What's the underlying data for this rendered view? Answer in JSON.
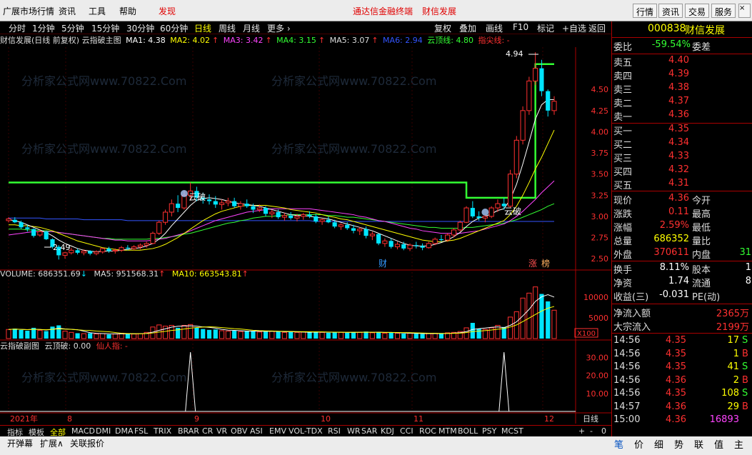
{
  "menubar": {
    "items": [
      "广展市场行情",
      "资讯",
      "工具",
      "帮助",
      "发现"
    ],
    "center_links": [
      "通达信金融终端",
      "财信发展"
    ],
    "right_buttons": [
      "行情",
      "资讯",
      "交易",
      "服务"
    ]
  },
  "period_bar": {
    "items": [
      "分时",
      "1分钟",
      "5分钟",
      "15分钟",
      "30分钟",
      "60分钟",
      "日线",
      "周线",
      "月线",
      "更多 ›"
    ],
    "active": "日线",
    "right_items": [
      "复权",
      "叠加",
      "画线",
      "F10",
      "标记",
      "+自选",
      "返回"
    ]
  },
  "chart_title": {
    "name": "财信发展(日线 前复权) 云指破主图",
    "ma1": "MA1: 4.38",
    "ma2": "MA2: 4.02",
    "ma3": "MA3: 3.42",
    "ma4": "MA4: 3.15",
    "ma5": "MA5: 3.07",
    "ma6": "MA6: 2.94",
    "yun": "云顶线: 4.80",
    "jian": "指尖线: -"
  },
  "volume_title": {
    "vol": "VOLUME: 686351.69",
    "ma5": "MA5: 951568.31",
    "ma10": "MA10: 663543.81"
  },
  "sub_title": {
    "name": "云指破副图",
    "ding": "云顶破: 0.00",
    "xian": "仙人指: -"
  },
  "annotations": {
    "high": "4.94",
    "low": "2.49",
    "yunpo1": "云破",
    "yunpo2": "云破",
    "cai": "财",
    "zhang": "涨",
    "bang": "榜"
  },
  "price_axis": [
    "4.50",
    "4.25",
    "4.00",
    "3.75",
    "3.50",
    "3.25",
    "3.00",
    "2.75",
    "2.50"
  ],
  "volume_axis": [
    "10000",
    "5000",
    "X100"
  ],
  "sub_axis": [
    "30.00",
    "20.00",
    "10.00"
  ],
  "date_axis": [
    "2021年",
    "8",
    "9",
    "10",
    "11",
    "12"
  ],
  "date_axis_right": "日线",
  "right_panel": {
    "code": "000838",
    "name": "财信发展",
    "weibi_label": "委比",
    "weibi_value": "-59.54%",
    "weicha_label": "委差",
    "sell": [
      {
        "label": "卖五",
        "price": "4.40"
      },
      {
        "label": "卖四",
        "price": "4.39"
      },
      {
        "label": "卖三",
        "price": "4.38"
      },
      {
        "label": "卖二",
        "price": "4.37"
      },
      {
        "label": "卖一",
        "price": "4.36"
      }
    ],
    "buy": [
      {
        "label": "买一",
        "price": "4.35"
      },
      {
        "label": "买二",
        "price": "4.34"
      },
      {
        "label": "买三",
        "price": "4.33"
      },
      {
        "label": "买四",
        "price": "4.32"
      },
      {
        "label": "买五",
        "price": "4.31"
      }
    ],
    "stats": [
      {
        "l1": "现价",
        "v1": "4.36",
        "l2": "今开",
        "v2": ""
      },
      {
        "l1": "涨跌",
        "v1": "0.11",
        "l2": "最高",
        "v2": ""
      },
      {
        "l1": "涨幅",
        "v1": "2.59%",
        "l2": "最低",
        "v2": ""
      },
      {
        "l1": "总量",
        "v1": "686352",
        "l2": "量比",
        "v2": ""
      },
      {
        "l1": "外盘",
        "v1": "370611",
        "l2": "内盘",
        "v2": "31"
      }
    ],
    "stats2": [
      {
        "l1": "换手",
        "v1": "8.11%",
        "l2": "股本",
        "v2": "1"
      },
      {
        "l1": "净资",
        "v1": "1.74",
        "l2": "流通",
        "v2": "8"
      },
      {
        "l1": "收益(三)",
        "v1": "-0.031",
        "l2": "PE(动)",
        "v2": ""
      }
    ],
    "flow": [
      {
        "label": "净流入额",
        "value": "2365万"
      },
      {
        "label": "大宗流入",
        "value": "2199万"
      }
    ],
    "ticks": [
      {
        "time": "14:56",
        "price": "4.35",
        "vol": "17",
        "bs": "S"
      },
      {
        "time": "14:56",
        "price": "4.35",
        "vol": "1",
        "bs": "B"
      },
      {
        "time": "14:56",
        "price": "4.35",
        "vol": "41",
        "bs": "S"
      },
      {
        "time": "14:56",
        "price": "4.36",
        "vol": "2",
        "bs": "B"
      },
      {
        "time": "14:56",
        "price": "4.35",
        "vol": "108",
        "bs": "S"
      },
      {
        "time": "14:57",
        "price": "4.36",
        "vol": "29",
        "bs": "B"
      },
      {
        "time": "15:00",
        "price": "4.36",
        "vol": "16893",
        "bs": ""
      }
    ]
  },
  "bottom_tabs": [
    "指标",
    "模板",
    "全部",
    "MACD",
    "DMI",
    "DMA",
    "FSL",
    "TRIX",
    "BRAR",
    "CR",
    "VR",
    "OBV",
    "ASI",
    "EMV",
    "VOL-TDX",
    "RSI",
    "WR",
    "SAR",
    "KDJ",
    "CCI",
    "ROC",
    "MTM",
    "BOLL",
    "PSY",
    "MCST"
  ],
  "bottom_selected": "全部",
  "bottom_right": [
    "+",
    "-",
    "0"
  ],
  "status_items": [
    "开弹幕",
    "扩展∧",
    "关联报价"
  ],
  "right_tabs": [
    "笔",
    "价",
    "细",
    "势",
    "联",
    "值",
    "主"
  ],
  "watermark": "分析家公式网www.70822.Com",
  "colors": {
    "up": "#ff3030",
    "down": "#00e5ff",
    "yunding": "#33ff33",
    "ma1": "#ffffff",
    "ma2": "#ffff00",
    "ma3": "#ff44ff",
    "ma4": "#33ff33",
    "ma5": "#cccccc",
    "ma6": "#3355ff"
  },
  "chart_data": {
    "type": "candlestick",
    "candles": [
      [
        2.95,
        2.99,
        2.93,
        2.97
      ],
      [
        2.96,
        2.99,
        2.92,
        2.93
      ],
      [
        2.93,
        2.95,
        2.85,
        2.87
      ],
      [
        2.87,
        2.9,
        2.82,
        2.85
      ],
      [
        2.85,
        2.86,
        2.75,
        2.77
      ],
      [
        2.78,
        2.85,
        2.76,
        2.82
      ],
      [
        2.82,
        2.83,
        2.72,
        2.73
      ],
      [
        2.73,
        2.74,
        2.62,
        2.64
      ],
      [
        2.64,
        2.66,
        2.49,
        2.54
      ],
      [
        2.54,
        2.58,
        2.5,
        2.57
      ],
      [
        2.57,
        2.63,
        2.55,
        2.6
      ],
      [
        2.6,
        2.62,
        2.55,
        2.57
      ],
      [
        2.57,
        2.61,
        2.54,
        2.59
      ],
      [
        2.59,
        2.6,
        2.54,
        2.56
      ],
      [
        2.56,
        2.6,
        2.54,
        2.58
      ],
      [
        2.58,
        2.63,
        2.56,
        2.62
      ],
      [
        2.62,
        2.64,
        2.57,
        2.59
      ],
      [
        2.59,
        2.62,
        2.56,
        2.6
      ],
      [
        2.6,
        2.65,
        2.58,
        2.63
      ],
      [
        2.63,
        2.66,
        2.6,
        2.62
      ],
      [
        2.62,
        2.66,
        2.6,
        2.64
      ],
      [
        2.64,
        2.68,
        2.61,
        2.66
      ],
      [
        2.66,
        2.7,
        2.63,
        2.68
      ],
      [
        2.68,
        2.82,
        2.67,
        2.8
      ],
      [
        2.8,
        2.95,
        2.78,
        2.93
      ],
      [
        2.93,
        3.08,
        2.9,
        3.05
      ],
      [
        3.05,
        3.2,
        3.0,
        3.15
      ],
      [
        3.15,
        3.25,
        3.05,
        3.1
      ],
      [
        3.1,
        3.3,
        3.08,
        3.25
      ],
      [
        3.25,
        3.4,
        3.2,
        3.3
      ],
      [
        3.3,
        3.35,
        3.18,
        3.22
      ],
      [
        3.22,
        3.28,
        3.15,
        3.2
      ],
      [
        3.2,
        3.26,
        3.14,
        3.18
      ],
      [
        3.18,
        3.24,
        3.1,
        3.14
      ],
      [
        3.14,
        3.2,
        3.08,
        3.16
      ],
      [
        3.16,
        3.22,
        3.12,
        3.18
      ],
      [
        3.18,
        3.22,
        3.1,
        3.12
      ],
      [
        3.12,
        3.18,
        3.08,
        3.15
      ],
      [
        3.15,
        3.2,
        3.1,
        3.12
      ],
      [
        3.12,
        3.15,
        3.04,
        3.08
      ],
      [
        3.08,
        3.14,
        3.05,
        3.1
      ],
      [
        3.1,
        3.12,
        3.0,
        3.03
      ],
      [
        3.03,
        3.08,
        2.98,
        3.05
      ],
      [
        3.05,
        3.08,
        2.97,
        2.99
      ],
      [
        2.99,
        3.04,
        2.95,
        3.01
      ],
      [
        3.01,
        3.05,
        2.96,
        2.98
      ],
      [
        2.98,
        3.03,
        2.94,
        3.0
      ],
      [
        3.0,
        3.04,
        2.96,
        3.02
      ],
      [
        3.02,
        3.06,
        2.98,
        3.0
      ],
      [
        3.0,
        3.03,
        2.92,
        2.94
      ],
      [
        2.94,
        2.98,
        2.9,
        2.96
      ],
      [
        2.96,
        3.0,
        2.92,
        2.93
      ],
      [
        2.93,
        2.96,
        2.86,
        2.88
      ],
      [
        2.88,
        2.92,
        2.84,
        2.9
      ],
      [
        2.9,
        2.93,
        2.84,
        2.86
      ],
      [
        2.86,
        2.9,
        2.8,
        2.83
      ],
      [
        2.83,
        2.87,
        2.78,
        2.85
      ],
      [
        2.85,
        2.88,
        2.74,
        2.77
      ],
      [
        2.77,
        2.82,
        2.72,
        2.79
      ],
      [
        2.79,
        2.8,
        2.66,
        2.68
      ],
      [
        2.68,
        2.74,
        2.64,
        2.71
      ],
      [
        2.71,
        2.74,
        2.62,
        2.64
      ],
      [
        2.64,
        2.7,
        2.61,
        2.67
      ],
      [
        2.67,
        2.7,
        2.6,
        2.62
      ],
      [
        2.62,
        2.68,
        2.59,
        2.66
      ],
      [
        2.66,
        2.7,
        2.62,
        2.65
      ],
      [
        2.65,
        2.68,
        2.6,
        2.63
      ],
      [
        2.63,
        2.7,
        2.62,
        2.68
      ],
      [
        2.68,
        2.75,
        2.66,
        2.73
      ],
      [
        2.73,
        2.78,
        2.7,
        2.72
      ],
      [
        2.72,
        2.8,
        2.7,
        2.78
      ],
      [
        2.78,
        2.86,
        2.75,
        2.84
      ],
      [
        2.84,
        2.95,
        2.82,
        2.93
      ],
      [
        2.93,
        3.12,
        2.92,
        3.1
      ],
      [
        3.1,
        3.18,
        2.98,
        3.0
      ],
      [
        3.0,
        3.06,
        2.95,
        2.98
      ],
      [
        2.98,
        3.02,
        2.93,
        3.0
      ],
      [
        3.0,
        3.12,
        2.98,
        3.1
      ],
      [
        3.1,
        3.2,
        3.05,
        3.15
      ],
      [
        3.15,
        3.22,
        3.08,
        3.12
      ],
      [
        3.12,
        3.55,
        3.1,
        3.5
      ],
      [
        3.5,
        3.95,
        3.45,
        3.9
      ],
      [
        3.9,
        4.3,
        3.85,
        4.25
      ],
      [
        4.25,
        4.65,
        4.2,
        4.6
      ],
      [
        4.6,
        4.94,
        4.55,
        4.75
      ],
      [
        4.75,
        4.85,
        4.42,
        4.48
      ],
      [
        4.48,
        4.5,
        4.18,
        4.25
      ],
      [
        4.25,
        4.42,
        4.2,
        4.36
      ]
    ],
    "volume": [
      2200,
      2400,
      2100,
      1900,
      2600,
      2000,
      1800,
      2900,
      3200,
      1800,
      1500,
      1300,
      1200,
      1300,
      1100,
      1200,
      1000,
      1100,
      1300,
      1200,
      1100,
      1200,
      1500,
      2800,
      3300,
      3000,
      3200,
      2600,
      3200,
      3400,
      2600,
      2300,
      2100,
      2200,
      1900,
      1800,
      1900,
      1700,
      1800,
      1900,
      1600,
      1700,
      1800,
      1700,
      1500,
      1600,
      1500,
      1600,
      1500,
      1700,
      1500,
      1400,
      1600,
      1500,
      1400,
      1600,
      1500,
      1700,
      1400,
      1600,
      1300,
      1400,
      1300,
      1200,
      1300,
      1200,
      1100,
      1200,
      1300,
      1200,
      1400,
      1500,
      1700,
      2600,
      3800,
      2400,
      2200,
      2600,
      3200,
      2800,
      5200,
      6500,
      9800,
      11000,
      12500,
      10800,
      9000,
      6864
    ],
    "ma1": [
      2.96,
      2.95,
      2.93,
      2.9,
      2.87,
      2.84,
      2.81,
      2.77,
      2.72,
      2.68,
      2.65,
      2.62,
      2.6,
      2.59,
      2.58,
      2.59,
      2.59,
      2.59,
      2.6,
      2.61,
      2.62,
      2.63,
      2.65,
      2.68,
      2.73,
      2.8,
      2.89,
      2.97,
      3.05,
      3.13,
      3.19,
      3.21,
      3.22,
      3.21,
      3.2,
      3.18,
      3.16,
      3.15,
      3.14,
      3.13,
      3.12,
      3.1,
      3.08,
      3.06,
      3.04,
      3.02,
      3.01,
      3.01,
      3.0,
      2.99,
      2.98,
      2.97,
      2.95,
      2.93,
      2.91,
      2.89,
      2.87,
      2.85,
      2.83,
      2.8,
      2.77,
      2.74,
      2.71,
      2.68,
      2.66,
      2.65,
      2.65,
      2.65,
      2.67,
      2.69,
      2.72,
      2.76,
      2.81,
      2.88,
      2.94,
      2.98,
      3.0,
      3.03,
      3.07,
      3.09,
      3.2,
      3.38,
      3.62,
      3.88,
      4.15,
      4.32,
      4.38,
      4.38
    ],
    "ma2": [
      2.9,
      2.9,
      2.89,
      2.89,
      2.88,
      2.87,
      2.85,
      2.83,
      2.8,
      2.77,
      2.74,
      2.71,
      2.69,
      2.67,
      2.65,
      2.63,
      2.62,
      2.61,
      2.6,
      2.6,
      2.6,
      2.6,
      2.61,
      2.62,
      2.64,
      2.67,
      2.71,
      2.75,
      2.8,
      2.85,
      2.9,
      2.95,
      2.99,
      3.03,
      3.06,
      3.08,
      3.1,
      3.12,
      3.13,
      3.13,
      3.13,
      3.13,
      3.12,
      3.11,
      3.1,
      3.08,
      3.07,
      3.06,
      3.05,
      3.04,
      3.02,
      3.0,
      2.99,
      2.97,
      2.96,
      2.94,
      2.92,
      2.9,
      2.88,
      2.86,
      2.84,
      2.82,
      2.8,
      2.78,
      2.76,
      2.74,
      2.72,
      2.71,
      2.7,
      2.7,
      2.71,
      2.72,
      2.74,
      2.77,
      2.8,
      2.83,
      2.86,
      2.89,
      2.92,
      2.95,
      3.02,
      3.12,
      3.25,
      3.4,
      3.56,
      3.7,
      3.86,
      4.02
    ],
    "ma3": [
      2.78,
      2.79,
      2.8,
      2.81,
      2.82,
      2.82,
      2.82,
      2.82,
      2.81,
      2.8,
      2.79,
      2.78,
      2.77,
      2.76,
      2.75,
      2.74,
      2.73,
      2.72,
      2.72,
      2.71,
      2.71,
      2.71,
      2.71,
      2.72,
      2.73,
      2.74,
      2.76,
      2.78,
      2.8,
      2.83,
      2.86,
      2.89,
      2.92,
      2.95,
      2.97,
      2.99,
      3.01,
      3.03,
      3.05,
      3.06,
      3.07,
      3.08,
      3.09,
      3.09,
      3.09,
      3.09,
      3.09,
      3.09,
      3.09,
      3.08,
      3.07,
      3.06,
      3.05,
      3.04,
      3.03,
      3.02,
      3.0,
      2.99,
      2.97,
      2.95,
      2.94,
      2.92,
      2.9,
      2.88,
      2.86,
      2.85,
      2.83,
      2.82,
      2.81,
      2.8,
      2.8,
      2.8,
      2.8,
      2.81,
      2.82,
      2.83,
      2.85,
      2.87,
      2.89,
      2.91,
      2.95,
      3.0,
      3.06,
      3.13,
      3.2,
      3.28,
      3.35,
      3.42
    ],
    "ma4": [
      2.85,
      2.85,
      2.85,
      2.84,
      2.84,
      2.83,
      2.83,
      2.82,
      2.81,
      2.8,
      2.79,
      2.78,
      2.77,
      2.76,
      2.75,
      2.74,
      2.74,
      2.73,
      2.73,
      2.73,
      2.73,
      2.73,
      2.73,
      2.74,
      2.74,
      2.75,
      2.76,
      2.77,
      2.79,
      2.8,
      2.82,
      2.84,
      2.86,
      2.88,
      2.9,
      2.92,
      2.93,
      2.95,
      2.96,
      2.98,
      2.99,
      3.0,
      3.0,
      3.01,
      3.01,
      3.02,
      3.02,
      3.02,
      3.02,
      3.02,
      3.02,
      3.01,
      3.01,
      3.0,
      2.99,
      2.99,
      2.98,
      2.97,
      2.96,
      2.95,
      2.94,
      2.93,
      2.92,
      2.91,
      2.9,
      2.89,
      2.88,
      2.87,
      2.87,
      2.86,
      2.86,
      2.86,
      2.86,
      2.87,
      2.87,
      2.88,
      2.89,
      2.9,
      2.91,
      2.92,
      2.94,
      2.96,
      2.99,
      3.02,
      3.05,
      3.08,
      3.12,
      3.15
    ],
    "ma6": [
      2.98,
      2.98,
      2.98,
      2.98,
      2.98,
      2.98,
      2.97,
      2.97,
      2.97,
      2.97,
      2.97,
      2.97,
      2.96,
      2.96,
      2.96,
      2.96,
      2.96,
      2.96,
      2.96,
      2.95,
      2.95,
      2.95,
      2.95,
      2.95,
      2.95,
      2.95,
      2.95,
      2.95,
      2.95,
      2.95,
      2.95,
      2.95,
      2.95,
      2.95,
      2.95,
      2.95,
      2.95,
      2.95,
      2.95,
      2.95,
      2.95,
      2.95,
      2.95,
      2.95,
      2.95,
      2.95,
      2.95,
      2.95,
      2.95,
      2.94,
      2.94,
      2.94,
      2.94,
      2.94,
      2.94,
      2.94,
      2.94,
      2.94,
      2.94,
      2.94,
      2.94,
      2.94,
      2.94,
      2.94,
      2.94,
      2.94,
      2.94,
      2.94,
      2.94,
      2.94,
      2.94,
      2.94,
      2.94,
      2.94,
      2.94,
      2.94,
      2.94,
      2.94,
      2.94,
      2.94,
      2.94,
      2.94,
      2.94,
      2.94,
      2.94,
      2.94,
      2.94,
      2.94
    ],
    "yunding": [
      3.4,
      3.4,
      3.4,
      3.4,
      3.4,
      3.4,
      3.4,
      3.4,
      3.4,
      3.4,
      3.4,
      3.4,
      3.4,
      3.4,
      3.4,
      3.4,
      3.4,
      3.4,
      3.4,
      3.4,
      3.4,
      3.4,
      3.4,
      3.4,
      3.4,
      3.4,
      3.4,
      3.4,
      3.4,
      3.4,
      3.4,
      3.4,
      3.4,
      3.4,
      3.4,
      3.4,
      3.4,
      3.4,
      3.4,
      3.4,
      3.4,
      3.4,
      3.4,
      3.4,
      3.4,
      3.4,
      3.4,
      3.4,
      3.4,
      3.4,
      3.4,
      3.4,
      3.4,
      3.4,
      3.4,
      3.4,
      3.4,
      3.4,
      3.4,
      3.4,
      3.4,
      3.4,
      3.4,
      3.4,
      3.4,
      3.4,
      3.4,
      3.4,
      3.4,
      3.4,
      3.4,
      3.4,
      3.4,
      3.22,
      3.22,
      3.22,
      3.22,
      3.22,
      3.22,
      3.22,
      3.22,
      3.22,
      3.22,
      3.22,
      4.8,
      4.8,
      4.8,
      4.8
    ],
    "ylim": [
      2.4,
      5.0
    ],
    "vlim": [
      0,
      14000
    ]
  }
}
